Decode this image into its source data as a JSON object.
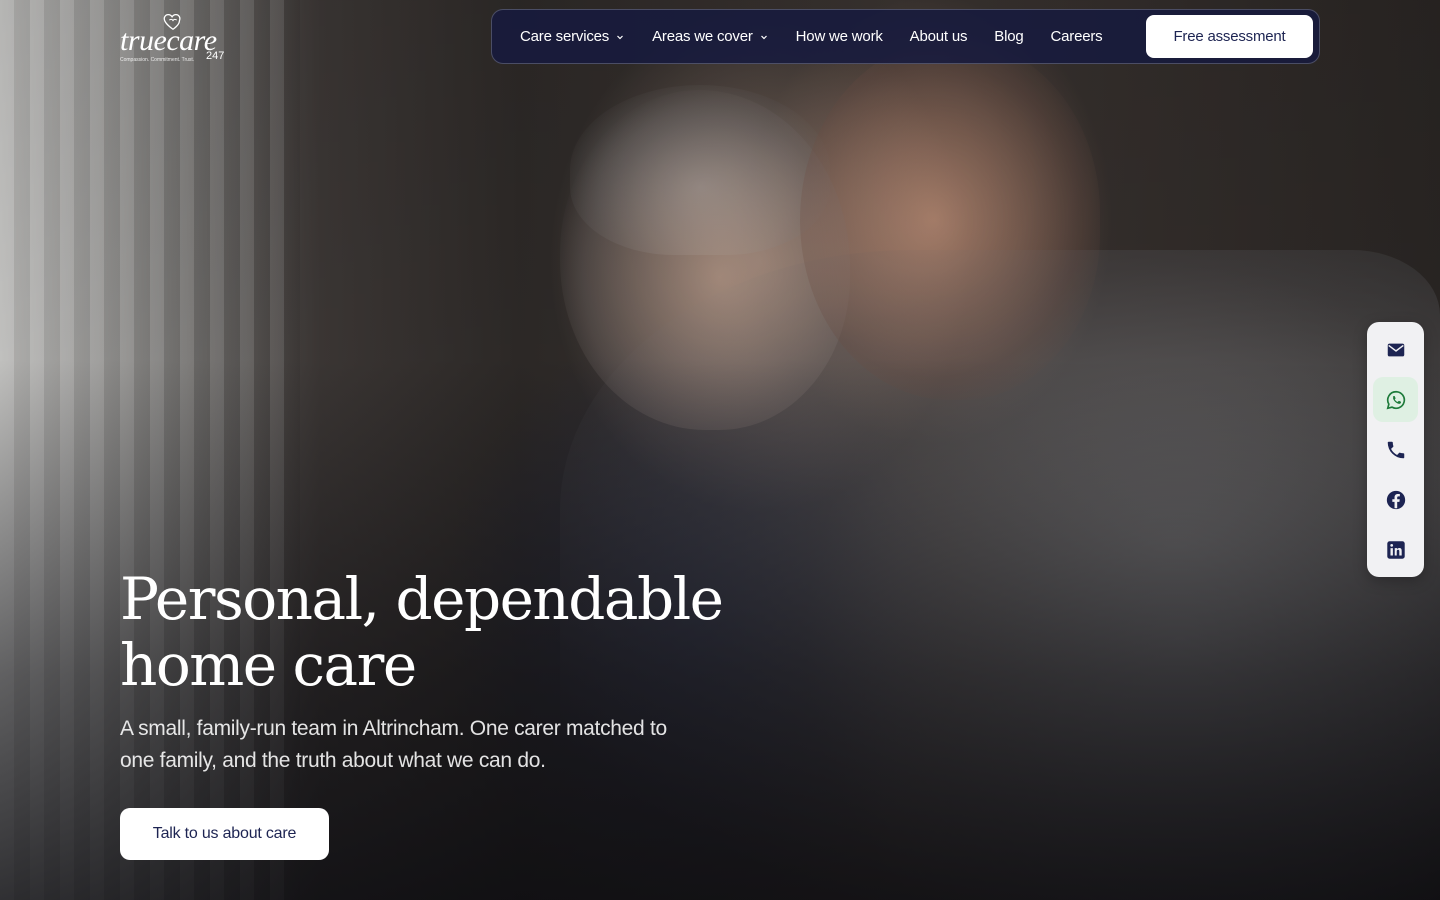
{
  "logo": {
    "wordmark": "truecare",
    "suffix": "247",
    "tagline": "Compassion. Commitment. Trust."
  },
  "nav": {
    "items": [
      {
        "label": "Care services",
        "has_dropdown": true
      },
      {
        "label": "Areas we cover",
        "has_dropdown": true
      },
      {
        "label": "How we work",
        "has_dropdown": false
      },
      {
        "label": "About us",
        "has_dropdown": false
      },
      {
        "label": "Blog",
        "has_dropdown": false
      },
      {
        "label": "Careers",
        "has_dropdown": false
      }
    ],
    "cta_label": "Free assessment"
  },
  "hero": {
    "title_line1": "Personal, dependable",
    "title_line2": "home care",
    "subtitle_line1": "A small, family-run team in Altrincham. One carer matched to",
    "subtitle_line2": "one family, and the truth about what we can do.",
    "cta_label": "Talk to us about care"
  },
  "contact_rail": {
    "buttons": [
      {
        "icon": "mail-icon",
        "active": false
      },
      {
        "icon": "whatsapp-icon",
        "active": true
      },
      {
        "icon": "phone-icon",
        "active": false
      },
      {
        "icon": "facebook-icon",
        "active": false
      },
      {
        "icon": "linkedin-icon",
        "active": false
      }
    ]
  },
  "colors": {
    "nav_bg": "#161a3e",
    "brand_navy": "#1d2452",
    "rail_bg": "#f1f1f3",
    "whatsapp_green": "#1d7a3a",
    "whatsapp_active_bg": "#dff0e3"
  }
}
